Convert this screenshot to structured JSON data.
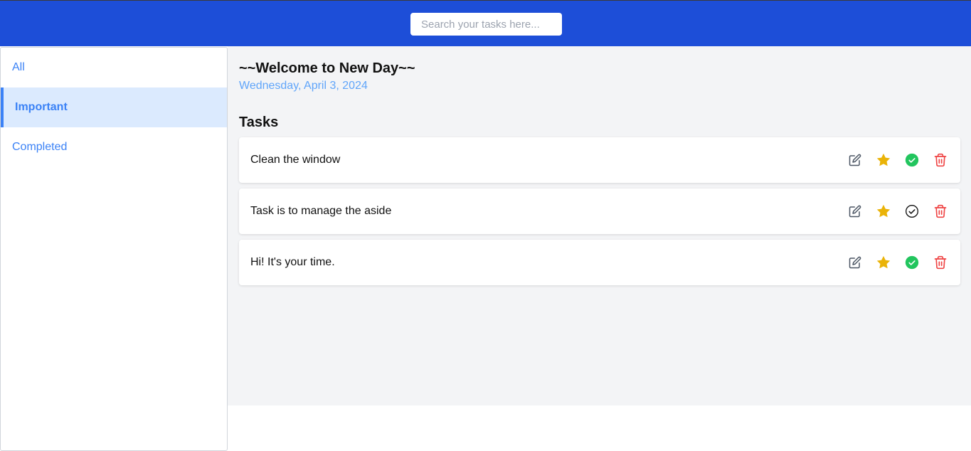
{
  "header": {
    "search_placeholder": "Search your tasks here..."
  },
  "sidebar": {
    "items": [
      {
        "label": "All",
        "active": false
      },
      {
        "label": "Important",
        "active": true
      },
      {
        "label": "Completed",
        "active": false
      }
    ]
  },
  "main": {
    "welcome": "~~Welcome to New Day~~",
    "date": "Wednesday, April 3, 2024",
    "tasks_title": "Tasks",
    "tasks": [
      {
        "text": "Clean the window",
        "important": true,
        "completed": true
      },
      {
        "text": "Task is to manage the aside",
        "important": true,
        "completed": false
      },
      {
        "text": "Hi! It's your time.",
        "important": true,
        "completed": true
      }
    ]
  },
  "colors": {
    "header": "#1d4ed8",
    "accent": "#3b82f6",
    "star": "#eab308",
    "complete": "#22c55e",
    "delete": "#ef4444"
  },
  "icons": [
    "edit-icon",
    "star-icon",
    "check-circle-icon",
    "trash-icon"
  ]
}
